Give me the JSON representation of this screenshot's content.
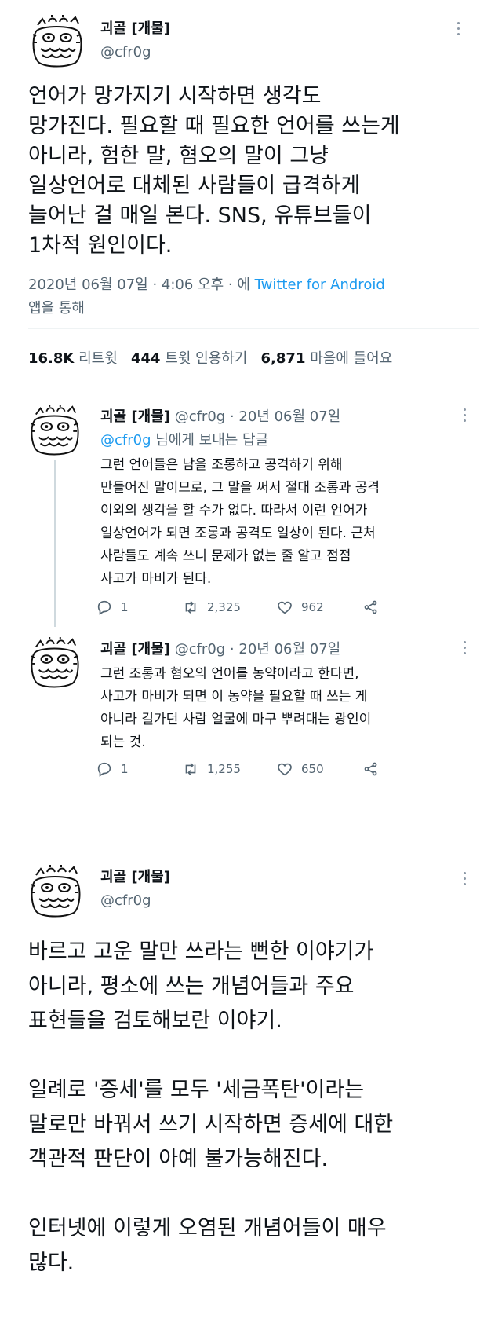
{
  "main_tweet": {
    "name": "괴골 [개물]",
    "handle": "@cfr0g",
    "text": "언어가 망가지기 시작하면 생각도\n망가진다. 필요할 때 필요한 언어를 쓰는게\n아니라, 험한 말, 혐오의 말이 그냥\n일상언어로 대체된 사람들이 급격하게\n늘어난 걸 매일 본다. SNS, 유튜브들이\n1차적 원인이다.",
    "date": "2020년 06월 07일 · 4:06 오후 · 에",
    "client": "Twitter for Android",
    "via": "앱을 통해",
    "stats": {
      "retweets": "16.8K",
      "retweets_label": "리트윗",
      "quotes": "444",
      "quotes_label": "트윗 인용하기",
      "likes": "6,871",
      "likes_label": "마음에 들어요"
    }
  },
  "reply1": {
    "name": "괴골 [개물]",
    "handle_date": "@cfr0g · 20년 06월 07일",
    "reply_to_handle": "@cfr0g",
    "reply_to_suffix": "님에게 보내는 답글",
    "text": "그런 언어들은 남을 조롱하고 공격하기 위해\n만들어진 말이므로, 그 말을 써서 절대 조롱과 공격\n이외의 생각을 할 수가 없다. 따라서 이런 언어가\n일상언어가 되면 조롱과 공격도 일상이 된다. 근처\n사람들도 계속 쓰니 문제가 없는 줄 알고 점점\n사고가 마비가 된다.",
    "replies": "1",
    "retweets": "2,325",
    "likes": "962"
  },
  "reply2": {
    "name": "괴골 [개물]",
    "handle_date": "@cfr0g · 20년 06월 07일",
    "text": "그런 조롱과 혐오의 언어를 농약이라고 한다면,\n사고가 마비가 되면 이 농약을 필요할 때 쓰는 게\n아니라 길가던 사람 얼굴에 마구 뿌려대는 광인이\n되는 것.",
    "replies": "1",
    "retweets": "1,255",
    "likes": "650"
  },
  "third_tweet": {
    "name": "괴골 [개물]",
    "handle": "@cfr0g",
    "text": "바르고 고운 말만 쓰라는 뻔한 이야기가\n아니라, 평소에 쓰는 개념어들과 주요\n표현들을 검토해보란 이야기.\n\n일례로 '증세'를 모두 '세금폭탄'이라는\n말로만 바꿔서 쓰기 시작하면 증세에 대한\n객관적 판단이 아예 불가능해진다.\n\n인터넷에 이렇게 오염된 개념어들이 매우\n많다."
  },
  "colors": {
    "text": "#0f1419",
    "muted": "#536471",
    "link": "#1d9bf0",
    "divider": "#eff3f4"
  },
  "icons": [
    "frog-avatar-icon",
    "more-icon",
    "reply-icon",
    "retweet-icon",
    "like-icon",
    "share-icon"
  ]
}
